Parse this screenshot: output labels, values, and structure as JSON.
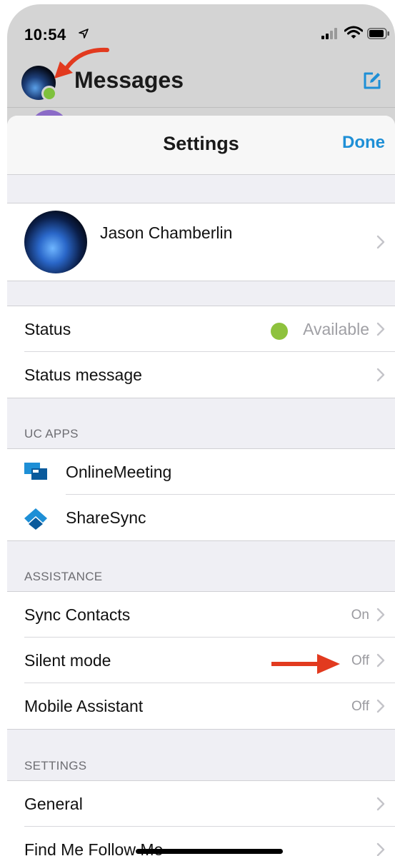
{
  "status_bar": {
    "time": "10:54"
  },
  "header": {
    "title": "Messages"
  },
  "settings": {
    "title": "Settings",
    "done_label": "Done",
    "profile": {
      "name": "Jason Chamberlin"
    },
    "status": {
      "label": "Status",
      "value": "Available",
      "dot_color": "#8ec23d"
    },
    "status_message": {
      "label": "Status message"
    },
    "uc_apps": {
      "header": "UC APPS",
      "items": [
        {
          "label": "OnlineMeeting",
          "icon": "online-meeting-icon"
        },
        {
          "label": "ShareSync",
          "icon": "sharesync-icon"
        }
      ]
    },
    "assistance": {
      "header": "ASSISTANCE",
      "items": [
        {
          "label": "Sync Contacts",
          "value": "On"
        },
        {
          "label": "Silent mode",
          "value": "Off"
        },
        {
          "label": "Mobile Assistant",
          "value": "Off"
        }
      ]
    },
    "settings_section": {
      "header": "SETTINGS",
      "items": [
        {
          "label": "General"
        },
        {
          "label": "Find Me Follow Me"
        }
      ]
    }
  },
  "colors": {
    "accent": "#1e8fd6",
    "annotation_arrow": "#e23a1f",
    "presence_green": "#7ec13d"
  }
}
